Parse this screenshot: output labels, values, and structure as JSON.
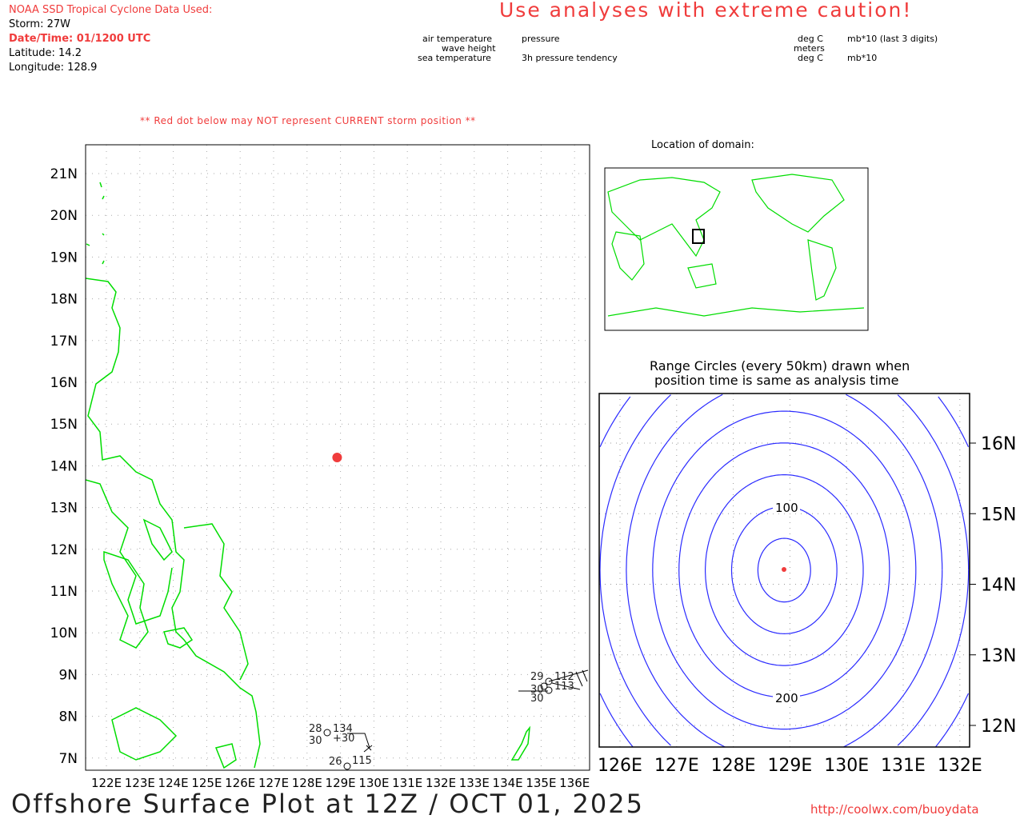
{
  "header": {
    "source": "NOAA SSD Tropical Cyclone Data Used:",
    "storm": "Storm: 27W",
    "datetime": "Date/Time: 01/1200 UTC",
    "latitude": "Latitude: 14.2",
    "longitude": "Longitude: 128.9",
    "caution": "Use analyses with extreme caution!"
  },
  "legend": {
    "air": "air temperature",
    "wave": "wave height",
    "sea": "sea temperature",
    "pressure": "pressure",
    "tendency": "3h pressure tendency",
    "air_unit": "deg C",
    "wave_unit": "meters",
    "sea_unit": "deg C",
    "pressure_unit": "mb*10 (last 3 digits)",
    "tendency_unit": "mb*10"
  },
  "warning": "** Red dot below may NOT represent CURRENT storm position **",
  "main_map": {
    "lat_labels": [
      "21N",
      "20N",
      "19N",
      "18N",
      "17N",
      "16N",
      "15N",
      "14N",
      "13N",
      "12N",
      "11N",
      "10N",
      "9N",
      "8N",
      "7N"
    ],
    "lon_labels": [
      "122E",
      "123E",
      "124E",
      "125E",
      "126E",
      "127E",
      "128E",
      "129E",
      "130E",
      "131E",
      "132E",
      "133E",
      "134E",
      "135E",
      "136E"
    ],
    "storm": {
      "lat": 14.2,
      "lon": 128.9,
      "color": "#f03c3c"
    },
    "obs": [
      {
        "air": "28",
        "pressure": "134",
        "sea": "30",
        "tendency": "+30"
      },
      {
        "air": "26",
        "pressure": "115"
      },
      {
        "air": "29",
        "pressure": "112"
      },
      {
        "air": "30",
        "pressure": "113"
      },
      {
        "air": "30"
      }
    ]
  },
  "locator": {
    "title": "Location of domain:"
  },
  "range": {
    "title1": "Range Circles (every 50km) drawn when",
    "title2": "position time is same as analysis time",
    "lat_labels": [
      "16N",
      "15N",
      "14N",
      "13N",
      "12N"
    ],
    "lon_labels": [
      "126E",
      "127E",
      "128E",
      "129E",
      "130E",
      "131E",
      "132E"
    ],
    "ring_label_100": "100",
    "ring_label_200": "200",
    "ring_color": "#2a2aff"
  },
  "footer": {
    "title": "Offshore Surface Plot at 12Z / OCT 01, 2025",
    "url": "http://coolwx.com/buoydata"
  }
}
